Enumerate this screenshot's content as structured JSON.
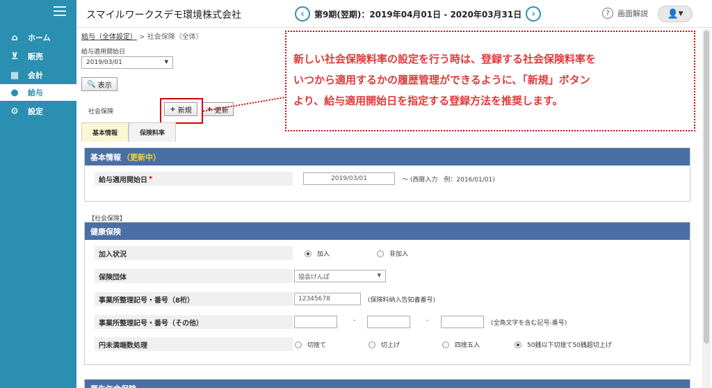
{
  "sidebar": {
    "items": [
      {
        "label": "ホーム",
        "icon": "home-icon",
        "glyph": "⌂"
      },
      {
        "label": "販売",
        "icon": "cart-icon",
        "glyph": "🛒"
      },
      {
        "label": "会計",
        "icon": "calculator-icon",
        "glyph": "▦"
      },
      {
        "label": "給与",
        "icon": "money-bag-icon",
        "glyph": "●"
      },
      {
        "label": "設定",
        "icon": "gear-icon",
        "glyph": "⚙"
      }
    ],
    "active_index": 3
  },
  "header": {
    "company": "スマイルワークスデモ環境株式会社",
    "period": "第9期(翌期)：2019年04月01日 - 2020年03月31日",
    "help_label": "画面解説",
    "prev": "‹",
    "next": "›"
  },
  "breadcrumb": {
    "link": "給与（全体設定）",
    "sep": " > ",
    "current": "社会保険（全体）"
  },
  "filter": {
    "date_label": "給与適用開始日",
    "date_value": "2019/03/01",
    "show_button": "表示"
  },
  "section_label": "社会保険",
  "new_button": "新規",
  "second_button": "更新",
  "callout": [
    "新しい社会保険料率の設定を行う時は、登録する社会保険料率を",
    "いつから適用するかの履歴管理ができるように、「新規」ボタン",
    "より、給与適用開始日を指定する登録方法を推奨します。"
  ],
  "tabs": [
    "基本情報",
    "保険料率"
  ],
  "basic": {
    "title": "基本情報",
    "status": "（更新中）",
    "start_label": "給与適用開始日",
    "start_value": "2019/03/01",
    "start_note": "～ (西暦入力　例：2016/01/01)"
  },
  "social_label": "【社会保険】",
  "health": {
    "title": "健康保険",
    "enroll_label": "加入状況",
    "enroll_options": [
      "加入",
      "非加入"
    ],
    "enroll_selected": 0,
    "group_label": "保険団体",
    "group_value": "協会けんぽ",
    "office_label": "事業所整理記号・番号（8桁）",
    "office_value": "12345678",
    "office_note": "(保険料納入告知書番号)",
    "other_label": "事業所整理記号・番号（その他）",
    "other_dash": "-",
    "other_note": "(全角文字を含む記号-番号)",
    "round_label": "円未満端数処理",
    "round_options": [
      "切捨て",
      "切上げ",
      "四捨五入",
      "50銭以下切捨て50銭超切上げ"
    ],
    "round_selected": 3
  },
  "pension": {
    "title": "厚生年金保険"
  }
}
